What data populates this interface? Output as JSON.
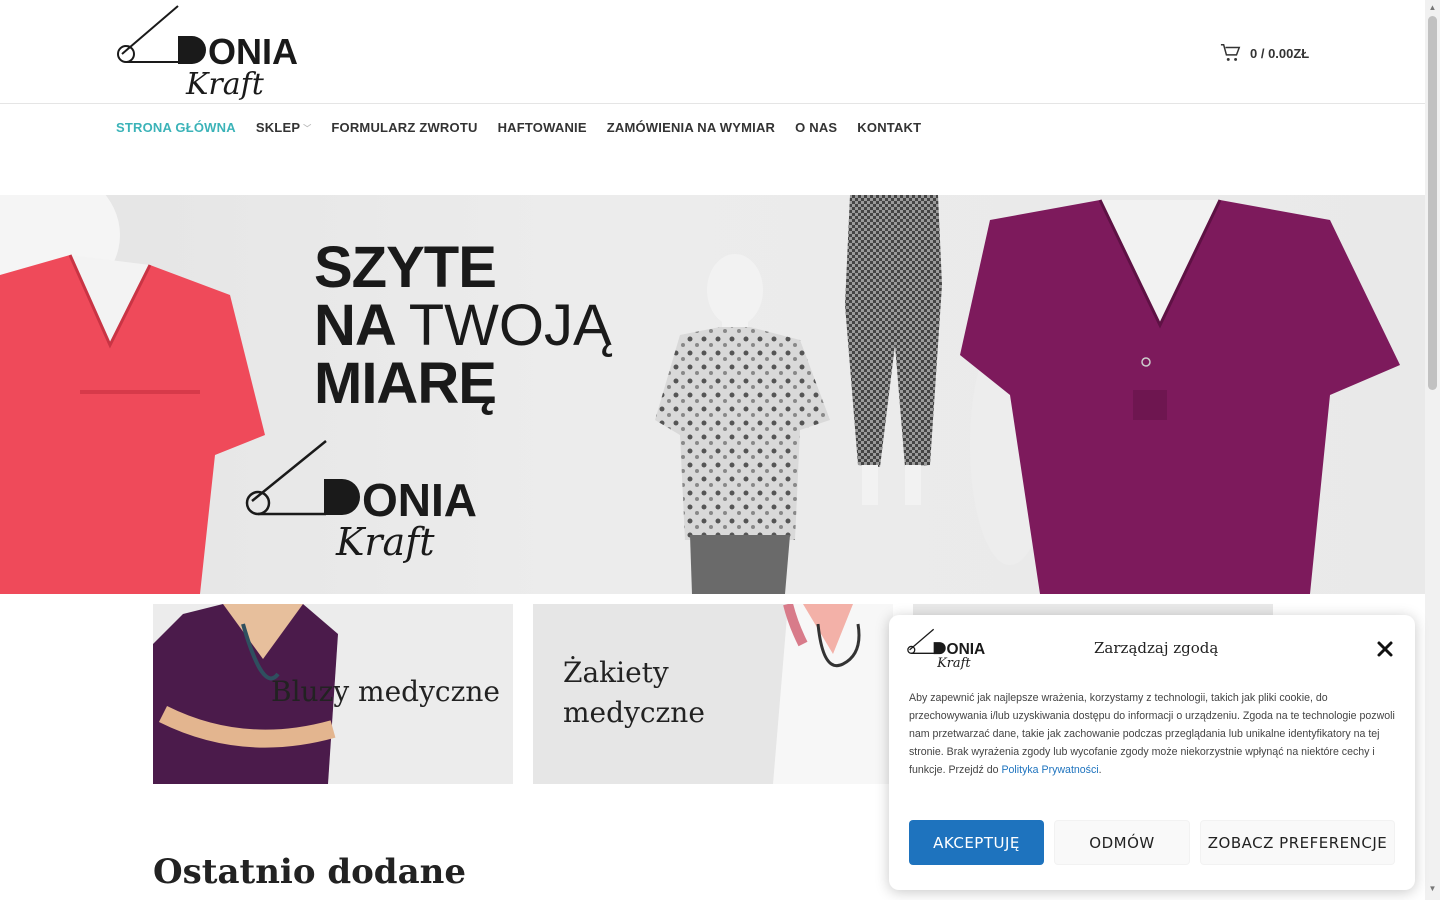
{
  "cart": {
    "text": "0 / 0.00ZŁ"
  },
  "nav": {
    "items": [
      {
        "label": "STRONA GŁÓWNA"
      },
      {
        "label": "SKLEP"
      },
      {
        "label": "FORMULARZ ZWROTU"
      },
      {
        "label": "HAFTOWANIE"
      },
      {
        "label": "ZAMÓWIENIA NA WYMIAR"
      },
      {
        "label": "O NAS"
      },
      {
        "label": "KONTAKT"
      }
    ]
  },
  "hero": {
    "line1": "SZYTE",
    "line2_bold": "NA",
    "line2_thin": "TWOJĄ",
    "line3": "MIARĘ"
  },
  "categories": [
    {
      "label": "Bluzy medyczne"
    },
    {
      "label": "Żakiety medyczne"
    }
  ],
  "section": {
    "title": "Ostatnio dodane"
  },
  "cookie": {
    "title": "Zarządzaj zgodą",
    "text": "Aby zapewnić jak najlepsze wrażenia, korzystamy z technologii, takich jak pliki cookie, do przechowywania i/lub uzyskiwania dostępu do informacji o urządzeniu. Zgoda na te technologie pozwoli nam przetwarzać dane, takie jak zachowanie podczas przeglądania lub unikalne identyfikatory na tej stronie. Brak wyrażenia zgody lub wycofanie zgody może niekorzystnie wpłynąć na niektóre cechy i funkcje. Przejdź do",
    "link": "Polityka Prywatności",
    "accept": "AKCEPTUJĘ",
    "deny": "ODMÓW",
    "prefs": "ZOBACZ PREFERENCJE"
  },
  "colors": {
    "accent": "#3bb3b8",
    "button_blue": "#1e73be",
    "burgundy": "#7d1a5c",
    "coral": "#ef4a5a",
    "purple": "#4b1b4b"
  }
}
